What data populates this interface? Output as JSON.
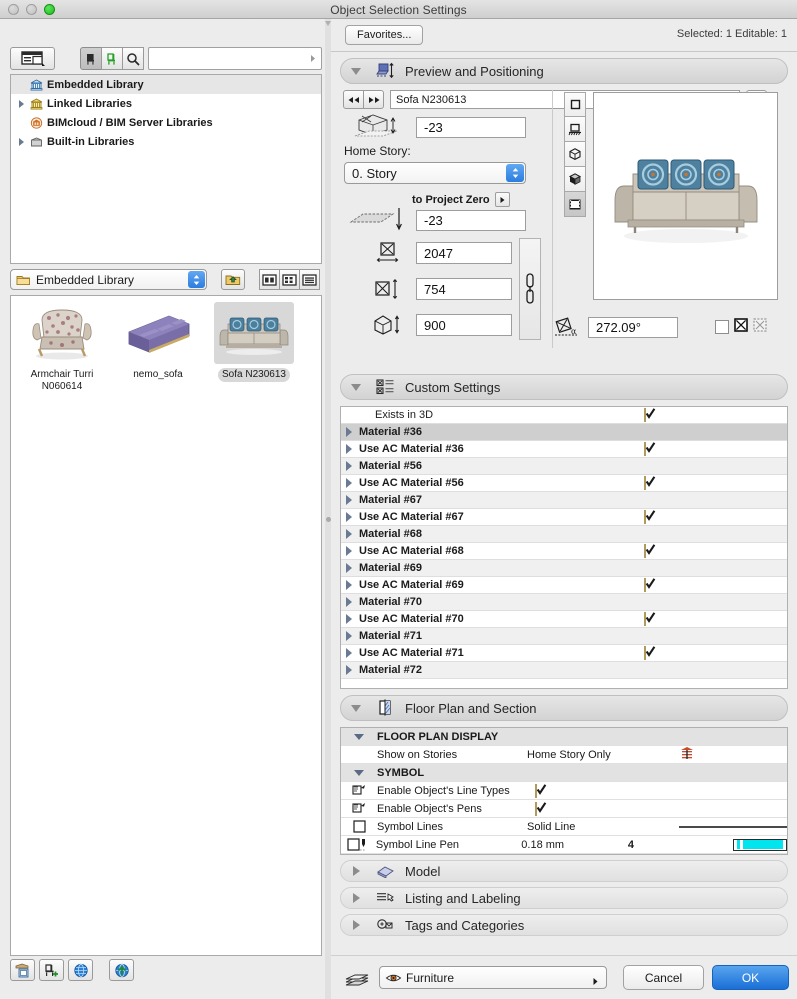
{
  "window": {
    "title": "Object Selection Settings",
    "controls": [
      "close-disabled",
      "minimize-disabled",
      "zoom-green"
    ]
  },
  "left_panel": {
    "toolbar": {
      "browse_mode_icon": "list-view-icon",
      "buttons": [
        {
          "name": "objects-filter",
          "icon": "chair-black-icon",
          "state": "pressed"
        },
        {
          "name": "new-objects-filter",
          "icon": "chair-green-icon",
          "state": "normal"
        },
        {
          "name": "search-button",
          "icon": "search-icon",
          "state": "normal"
        }
      ],
      "search_value": "",
      "search_placeholder": ""
    },
    "tree": {
      "items": [
        {
          "label": "Embedded Library",
          "icon": "bank-blue-icon",
          "twisty": "none",
          "selected": true,
          "indent": 0
        },
        {
          "label": "Linked Libraries",
          "icon": "bank-yellow-icon",
          "twisty": "right",
          "selected": false,
          "indent": 0
        },
        {
          "label": "BIMcloud / BIM Server Libraries",
          "icon": "bank-orange-icon",
          "twisty": "none",
          "selected": false,
          "indent": 0
        },
        {
          "label": "Built-in Libraries",
          "icon": "box-grey-icon",
          "twisty": "right",
          "selected": false,
          "indent": 0
        }
      ]
    },
    "folder_bar": {
      "folder_label": "Embedded Library",
      "folder_icon": "folder-icon",
      "up_button_icon": "folder-up-icon",
      "view_modes": [
        {
          "name": "view-mode-columns",
          "icon": "columns-view-icon",
          "selected": false
        },
        {
          "name": "view-mode-grid",
          "icon": "grid-view-icon",
          "selected": false
        },
        {
          "name": "view-mode-list",
          "icon": "list-view-icon",
          "selected": false
        }
      ]
    },
    "gallery": {
      "items": [
        {
          "name": "Armchair Turri N060614",
          "line1": "Armchair Turri",
          "line2": "N060614",
          "selected": false
        },
        {
          "name": "nemo_sofa",
          "line1": "nemo_sofa",
          "line2": "",
          "selected": false
        },
        {
          "name": "Sofa N230613",
          "line1": "Sofa N230613",
          "line2": "",
          "selected": true
        }
      ]
    },
    "bottom_buttons": [
      {
        "name": "embed-object-button",
        "icon": "embed-object-icon"
      },
      {
        "name": "add-object-button",
        "icon": "chair-plus-icon"
      },
      {
        "name": "globe-button",
        "icon": "globe-icon"
      },
      {
        "name": "download-button",
        "icon": "globe-upload-icon"
      }
    ]
  },
  "right_panel": {
    "favorites_label": "Favorites...",
    "selection_info": "Selected: 1 Editable: 1",
    "sections": [
      {
        "title": "Preview and Positioning",
        "icon": "preview-positioning-icon",
        "expanded": true
      },
      {
        "title": "Custom Settings",
        "icon": "custom-settings-icon",
        "expanded": true
      },
      {
        "title": "Floor Plan and Section",
        "icon": "floor-plan-section-icon",
        "expanded": true
      },
      {
        "title": "Model",
        "icon": "model-icon",
        "expanded": false
      },
      {
        "title": "Listing and Labeling",
        "icon": "listing-labeling-icon",
        "expanded": false
      },
      {
        "title": "Tags and Categories",
        "icon": "tags-categories-icon",
        "expanded": false
      }
    ],
    "preview_positioning": {
      "prev_button_icon": "rewind-icon",
      "next_button_icon": "fast-forward-icon",
      "object_name": "Sofa N230613",
      "info_button_icon": "info-icon",
      "elevation_to_home_story": "-23",
      "home_story_label": "Home Story:",
      "home_story_value": "0. Story",
      "to_project_zero_label": "to Project Zero",
      "elevation_to_project_zero": "-23",
      "size_x": "2047",
      "size_y": "754",
      "size_z": "900",
      "link_icon": "chain-link-icon",
      "angle_value": "272.09°",
      "preview_modes": [
        {
          "name": "preview-2d-symbol",
          "icon": "square-2d-icon",
          "selected": false
        },
        {
          "name": "preview-front-view",
          "icon": "front-view-icon",
          "selected": false
        },
        {
          "name": "preview-3d-wireframe",
          "icon": "cube-wire-icon",
          "selected": false
        },
        {
          "name": "preview-3d-shaded",
          "icon": "cube-shaded-icon",
          "selected": false
        },
        {
          "name": "preview-image",
          "icon": "filmstrip-icon",
          "selected": true
        }
      ],
      "preview_image_alt": "Sofa with three blue cushions"
    },
    "custom_settings": {
      "rows": [
        {
          "label": "Exists in 3D",
          "twisty": false,
          "checked": true,
          "selected": false,
          "bold": false
        },
        {
          "label": "Material #36",
          "twisty": true,
          "checked": null,
          "selected": true,
          "bold": true
        },
        {
          "label": "Use AC Material #36",
          "twisty": true,
          "checked": true,
          "selected": false,
          "bold": true
        },
        {
          "label": "Material #56",
          "twisty": true,
          "checked": null,
          "selected": false,
          "bold": true
        },
        {
          "label": "Use AC Material #56",
          "twisty": true,
          "checked": true,
          "selected": false,
          "bold": true
        },
        {
          "label": "Material #67",
          "twisty": true,
          "checked": null,
          "selected": false,
          "bold": true
        },
        {
          "label": "Use AC Material #67",
          "twisty": true,
          "checked": true,
          "selected": false,
          "bold": true
        },
        {
          "label": "Material #68",
          "twisty": true,
          "checked": null,
          "selected": false,
          "bold": true
        },
        {
          "label": "Use AC Material #68",
          "twisty": true,
          "checked": true,
          "selected": false,
          "bold": true
        },
        {
          "label": "Material #69",
          "twisty": true,
          "checked": null,
          "selected": false,
          "bold": true
        },
        {
          "label": "Use AC Material #69",
          "twisty": true,
          "checked": true,
          "selected": false,
          "bold": true
        },
        {
          "label": "Material #70",
          "twisty": true,
          "checked": null,
          "selected": false,
          "bold": true
        },
        {
          "label": "Use AC Material #70",
          "twisty": true,
          "checked": true,
          "selected": false,
          "bold": true
        },
        {
          "label": "Material #71",
          "twisty": true,
          "checked": null,
          "selected": false,
          "bold": true
        },
        {
          "label": "Use AC Material #71",
          "twisty": true,
          "checked": true,
          "selected": false,
          "bold": true
        },
        {
          "label": "Material #72",
          "twisty": true,
          "checked": null,
          "selected": false,
          "bold": true
        }
      ]
    },
    "floor_plan_section": {
      "rows": [
        {
          "type": "group",
          "twisty": "down",
          "label": "FLOOR PLAN DISPLAY"
        },
        {
          "type": "value",
          "icon": "",
          "label": "Show on Stories",
          "value": "Home Story Only",
          "extra_icon": "stories-icon"
        },
        {
          "type": "group",
          "twisty": "down",
          "label": "SYMBOL"
        },
        {
          "type": "check",
          "icon": "pen-override-icon",
          "label": "Enable Object's Line Types",
          "checked": true
        },
        {
          "type": "check",
          "icon": "pen-override-icon",
          "label": "Enable Object's Pens",
          "checked": true
        },
        {
          "type": "line",
          "icon": "empty-box-icon",
          "label": "Symbol Lines",
          "value": "Solid Line",
          "swatch": "line"
        },
        {
          "type": "pen",
          "icon": "pen-box-icon",
          "label": "Symbol Line Pen",
          "value": "0.18 mm",
          "number": "4",
          "color": "#00e5ee"
        }
      ]
    },
    "footer": {
      "layer_icon": "layers-icon",
      "layer_eye_icon": "eye-icon",
      "layer_value": "Furniture",
      "cancel_label": "Cancel",
      "ok_label": "OK"
    }
  }
}
